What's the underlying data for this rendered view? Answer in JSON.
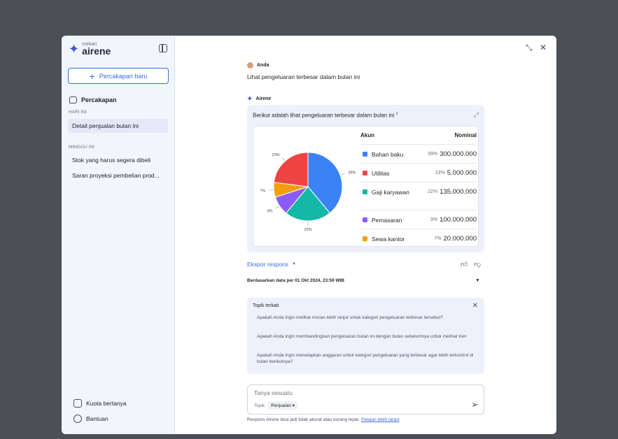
{
  "sidebar": {
    "brand_small": "mekari",
    "brand_name": "airene",
    "new_chat_label": "Percakapan baru",
    "section_title": "Percakapan",
    "groups": [
      {
        "label": "HARI INI",
        "items": [
          "Detail penjualan bulan ini"
        ]
      },
      {
        "label": "MINGGU INI",
        "items": [
          "Stok yang harus segera dibeli",
          "Saran proyeksi pembelian prod..."
        ]
      }
    ],
    "footer": {
      "quota_label": "Kuota bertanya",
      "help_label": "Bantuan"
    }
  },
  "chat": {
    "user_name": "Anda",
    "user_message": "Lihat pengeluaran terbesar dalam bulan ini",
    "bot_name": "Airene",
    "answer_intro": "Berikut adalah lihat pengeluaran terbesar dalam bulan ini",
    "answer_footnote": "1",
    "table": {
      "col_account": "Akun",
      "col_nominal": "Nominal",
      "rows": [
        {
          "name": "Bahan baku",
          "pct": "39%",
          "value": "300.000.000",
          "color": "#3b82f6"
        },
        {
          "name": "Utilitas",
          "pct": "23%",
          "value": "5.000.000",
          "color": "#ef4444"
        },
        {
          "name": "Gaji karyawan",
          "pct": "22%",
          "value": "135.000.000",
          "color": "#14b8a6"
        },
        {
          "name": "Pemasaran",
          "pct": "9%",
          "value": "100.000.000",
          "color": "#8b5cf6"
        },
        {
          "name": "Sewa kantor",
          "pct": "7%",
          "value": "20.000.000",
          "color": "#f59e0b"
        }
      ]
    },
    "export_label": "Ekspor respons",
    "data_basis": "Berdasarkan data per 01 Okt 2024, 23:59 WIB"
  },
  "chart_data": {
    "type": "pie",
    "categories": [
      "Bahan baku",
      "Gaji karyawan",
      "Pemasaran",
      "Sewa kantor",
      "Utilitas"
    ],
    "values": [
      39,
      22,
      9,
      7,
      23
    ],
    "labels": [
      "39%",
      "22%",
      "9%",
      "7%",
      "23%"
    ],
    "colors": [
      "#3b82f6",
      "#14b8a6",
      "#8b5cf6",
      "#f59e0b",
      "#ef4444"
    ]
  },
  "topics": {
    "title": "Topik terkait",
    "items": [
      "Apakah Anda ingin melihat rincian lebih lanjut untuk kategori pengeluaran terbesar tersebut?",
      "Apakah Anda ingin membandingkan pengeluaran bulan ini dengan bulan sebelumnya untuk melihat tren",
      "Apakah Anda ingin menetapkan anggaran untuk kategori pengeluaran yang terbesar agar lebih terkontrol di bulan berikutnya?"
    ]
  },
  "composer": {
    "placeholder": "Tanya sesuatu",
    "topic_label": "Topik",
    "topic_value": "Penjualan"
  },
  "disclaimer": {
    "text": "Respons Airene bisa jadi tidak akurat atau kurang tepat.",
    "link": "Pelajari lebih lanjut"
  }
}
